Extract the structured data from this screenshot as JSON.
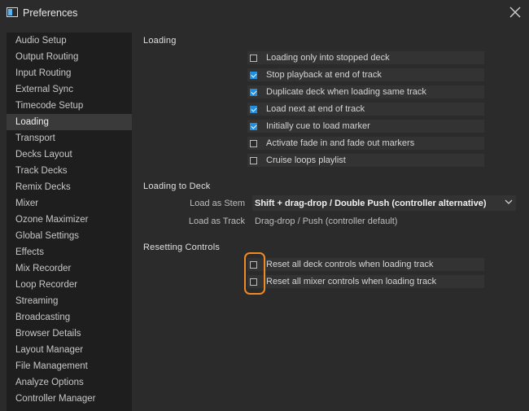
{
  "window": {
    "title": "Preferences"
  },
  "sidebar": {
    "items": [
      {
        "label": "Audio Setup"
      },
      {
        "label": "Output Routing"
      },
      {
        "label": "Input Routing"
      },
      {
        "label": "External Sync"
      },
      {
        "label": "Timecode Setup"
      },
      {
        "label": "Loading",
        "active": true
      },
      {
        "label": "Transport"
      },
      {
        "label": "Decks Layout"
      },
      {
        "label": "Track Decks"
      },
      {
        "label": "Remix Decks"
      },
      {
        "label": "Mixer"
      },
      {
        "label": "Ozone Maximizer"
      },
      {
        "label": "Global Settings"
      },
      {
        "label": "Effects"
      },
      {
        "label": "Mix Recorder"
      },
      {
        "label": "Loop Recorder"
      },
      {
        "label": "Streaming"
      },
      {
        "label": "Broadcasting"
      },
      {
        "label": "Browser Details"
      },
      {
        "label": "Layout Manager"
      },
      {
        "label": "File Management"
      },
      {
        "label": "Analyze Options"
      },
      {
        "label": "Controller Manager"
      }
    ]
  },
  "loading": {
    "title": "Loading",
    "options": [
      {
        "label": "Loading only into stopped deck",
        "checked": false
      },
      {
        "label": "Stop playback at end of track",
        "checked": true
      },
      {
        "label": "Duplicate deck when loading same track",
        "checked": true
      },
      {
        "label": "Load next at end of track",
        "checked": true
      },
      {
        "label": "Initially cue to load marker",
        "checked": true
      },
      {
        "label": "Activate fade in and fade out markers",
        "checked": false
      },
      {
        "label": "Cruise loops playlist",
        "checked": false
      }
    ]
  },
  "loading_to_deck": {
    "title": "Loading to Deck",
    "stem_label": "Load as Stem",
    "stem_value": "Shift + drag-drop / Double Push (controller alternative)",
    "track_label": "Load as Track",
    "track_value": "Drag-drop / Push (controller default)"
  },
  "resetting": {
    "title": "Resetting Controls",
    "options": [
      {
        "label": "Reset all deck controls when loading track",
        "checked": false
      },
      {
        "label": "Reset all mixer controls when loading track",
        "checked": false
      }
    ]
  },
  "colors": {
    "accent": "#1f8fe5",
    "highlight": "#f08a24"
  }
}
